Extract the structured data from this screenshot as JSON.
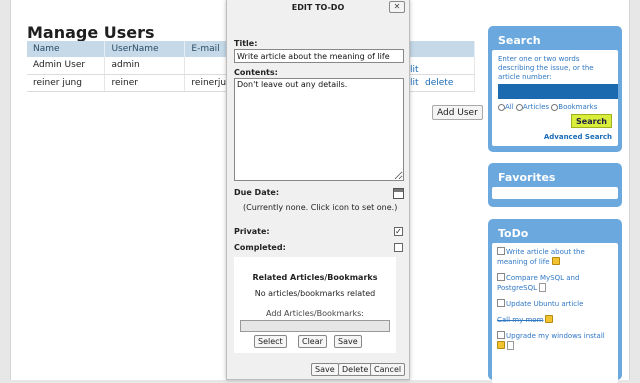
{
  "manage_users": {
    "title": "Manage Users",
    "columns": [
      "Name",
      "UserName",
      "E-mail"
    ],
    "rows": [
      {
        "name": "Admin User",
        "username": "admin",
        "email": "",
        "actions": [
          "lit"
        ]
      },
      {
        "name": "reiner jung",
        "username": "reiner",
        "email": "reinerju@",
        "actions": [
          "lit",
          "delete"
        ]
      }
    ],
    "add_user_label": "Add User"
  },
  "modal": {
    "title": "EDIT TO-DO",
    "close_label": "✕",
    "title_label": "Title:",
    "title_value": "Write article about the meaning of life",
    "contents_label": "Contents:",
    "contents_value": "Don't leave out any details.",
    "due_date_label": "Due Date:",
    "due_date_note": "(Currently none. Click icon to set one.)",
    "private_label": "Private:",
    "private_checked": true,
    "completed_label": "Completed:",
    "completed_checked": false,
    "related": {
      "title": "Related Articles/Bookmarks",
      "none_text": "No articles/bookmarks related",
      "add_label": "Add Articles/Bookmarks:",
      "select_label": "Select",
      "clear_label": "Clear",
      "save_label": "Save"
    },
    "footer": {
      "save_label": "Save",
      "delete_label": "Delete",
      "cancel_label": "Cancel"
    }
  },
  "search": {
    "title": "Search",
    "description": "Enter one or two words describing the issue, or the article number:",
    "input_value": "",
    "options": [
      "All",
      "Articles",
      "Bookmarks"
    ],
    "button_label": "Search",
    "advanced_label": "Advanced Search"
  },
  "favorites": {
    "title": "Favorites"
  },
  "todo": {
    "title": "ToDo",
    "items": [
      {
        "text": "Write article about the meaning of life",
        "completed": false,
        "private": true,
        "related": false
      },
      {
        "text": "Compare MySQL and PostgreSQL",
        "completed": false,
        "private": false,
        "related": true
      },
      {
        "text": "Update Ubuntu article",
        "completed": false,
        "private": false,
        "related": false
      },
      {
        "text": "Call my mom",
        "completed": true,
        "private": true,
        "related": false
      },
      {
        "text": "Upgrade my windows install",
        "completed": false,
        "private": true,
        "related": true
      }
    ]
  }
}
